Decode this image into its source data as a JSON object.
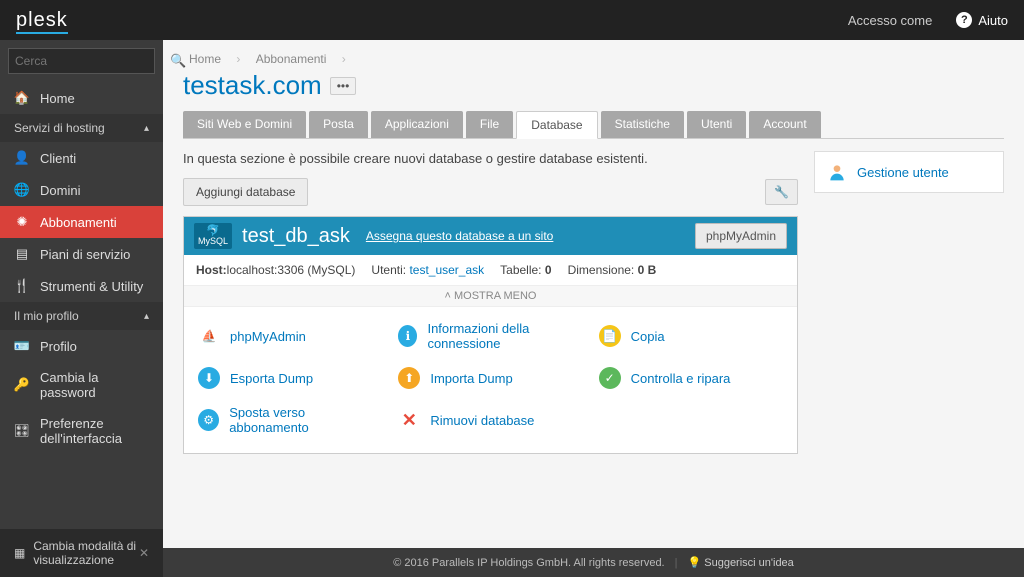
{
  "header": {
    "logo": "plesk",
    "access": "Accesso come",
    "help": "Aiuto"
  },
  "search": {
    "placeholder": "Cerca"
  },
  "nav": {
    "home": "Home",
    "section_hosting": "Servizi di hosting",
    "clienti": "Clienti",
    "domini": "Domini",
    "abbonamenti": "Abbonamenti",
    "piani": "Piani di servizio",
    "strumenti": "Strumenti & Utility",
    "section_profile": "Il mio profilo",
    "profilo": "Profilo",
    "password": "Cambia la password",
    "preferenze": "Preferenze dell'interfaccia"
  },
  "bottom_panel": {
    "text": "Cambia modalità di visualizzazione"
  },
  "breadcrumb": {
    "home": "Home",
    "sub": "Abbonamenti"
  },
  "page": {
    "title": "testask.com"
  },
  "tabs": {
    "siti": "Siti Web e Domini",
    "posta": "Posta",
    "app": "Applicazioni",
    "file": "File",
    "db": "Database",
    "stat": "Statistiche",
    "utenti": "Utenti",
    "account": "Account"
  },
  "intro": "In questa sezione è possibile creare nuovi database o gestire database esistenti.",
  "toolbar": {
    "add_db": "Aggiungi database"
  },
  "side": {
    "user_mgmt": "Gestione utente"
  },
  "db": {
    "engine": "MySQL",
    "name": "test_db_ask",
    "assign": "Assegna questo database a un sito",
    "pma": "phpMyAdmin",
    "meta_host_label": "Host:",
    "meta_host": "localhost:3306 (MySQL)",
    "meta_users_label": "Utenti:",
    "meta_user": "test_user_ask",
    "meta_tables_label": "Tabelle:",
    "meta_tables": "0",
    "meta_size_label": "Dimensione:",
    "meta_size": "0 B",
    "toggle": "MOSTRA MENO",
    "actions": {
      "pma": "phpMyAdmin",
      "conn": "Informazioni della connessione",
      "copy": "Copia",
      "export": "Esporta Dump",
      "import": "Importa Dump",
      "check": "Controlla e ripara",
      "move": "Sposta verso abbonamento",
      "remove": "Rimuovi database"
    }
  },
  "footer": {
    "copyright": "© 2016 Parallels IP Holdings GmbH. All rights reserved.",
    "idea": "Suggerisci un'idea"
  }
}
